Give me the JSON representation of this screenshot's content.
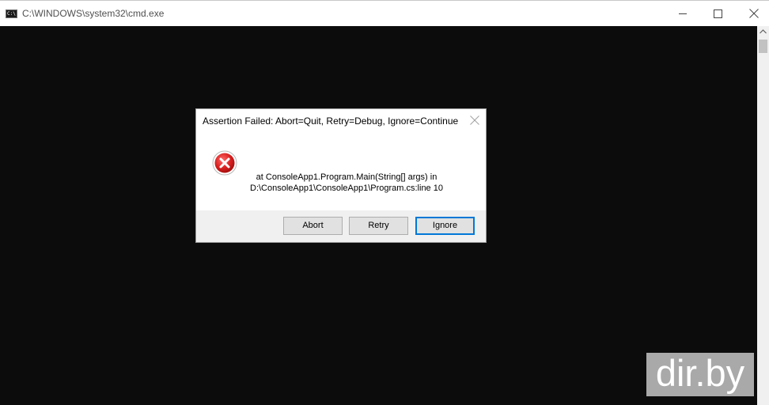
{
  "window": {
    "title": "C:\\WINDOWS\\system32\\cmd.exe",
    "icon_text": "C:\\.",
    "background_color": "#0c0c0c"
  },
  "dialog": {
    "title": "Assertion Failed: Abort=Quit, Retry=Debug, Ignore=Continue",
    "message_lines": [
      "at ConsoleApp1.Program.Main(String[] args) in",
      "D:\\ConsoleApp1\\ConsoleApp1\\Program.cs:line 10"
    ],
    "buttons": {
      "abort": "Abort",
      "retry": "Retry",
      "ignore": "Ignore"
    },
    "error_color": "#e81123"
  },
  "watermark": {
    "text": "dir.by"
  }
}
